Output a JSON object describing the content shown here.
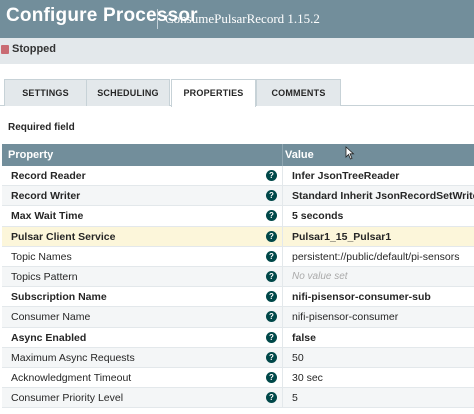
{
  "header": {
    "title": "Configure Processor",
    "subtitle": "ConsumePulsarRecord 1.15.2"
  },
  "status": {
    "text": "Stopped",
    "color": "#c96b73"
  },
  "tabs": [
    {
      "label": "SETTINGS",
      "active": false
    },
    {
      "label": "SCHEDULING",
      "active": false
    },
    {
      "label": "PROPERTIES",
      "active": true
    },
    {
      "label": "COMMENTS",
      "active": false
    }
  ],
  "required_label": "Required field",
  "table": {
    "columns": [
      "Property",
      "Value"
    ],
    "rows": [
      {
        "name": "Record Reader",
        "value": "Infer JsonTreeReader",
        "required": true,
        "highlight": false,
        "unset": false,
        "help_icon": "question-circle-icon"
      },
      {
        "name": "Record Writer",
        "value": "Standard Inherit JsonRecordSetWriter",
        "required": true,
        "highlight": false,
        "unset": false,
        "help_icon": "question-circle-icon"
      },
      {
        "name": "Max Wait Time",
        "value": "5 seconds",
        "required": true,
        "highlight": false,
        "unset": false,
        "help_icon": "question-circle-icon"
      },
      {
        "name": "Pulsar Client Service",
        "value": "Pulsar1_15_Pulsar1",
        "required": true,
        "highlight": true,
        "unset": false,
        "help_icon": "question-circle-icon"
      },
      {
        "name": "Topic Names",
        "value": "persistent://public/default/pi-sensors",
        "required": false,
        "highlight": false,
        "unset": false,
        "help_icon": "question-circle-icon"
      },
      {
        "name": "Topics Pattern",
        "value": "No value set",
        "required": false,
        "highlight": false,
        "unset": true,
        "help_icon": "question-circle-icon"
      },
      {
        "name": "Subscription Name",
        "value": "nifi-pisensor-consumer-sub",
        "required": true,
        "highlight": false,
        "unset": false,
        "help_icon": "question-circle-icon"
      },
      {
        "name": "Consumer Name",
        "value": "nifi-pisensor-consumer",
        "required": false,
        "highlight": false,
        "unset": false,
        "help_icon": "question-circle-icon"
      },
      {
        "name": "Async Enabled",
        "value": "false",
        "required": true,
        "highlight": false,
        "unset": false,
        "help_icon": "question-circle-icon"
      },
      {
        "name": "Maximum Async Requests",
        "value": "50",
        "required": false,
        "highlight": false,
        "unset": false,
        "help_icon": "question-circle-icon"
      },
      {
        "name": "Acknowledgment Timeout",
        "value": "30 sec",
        "required": false,
        "highlight": false,
        "unset": false,
        "help_icon": "question-circle-icon"
      },
      {
        "name": "Consumer Priority Level",
        "value": "5",
        "required": false,
        "highlight": false,
        "unset": false,
        "help_icon": "question-circle-icon"
      }
    ]
  },
  "colors": {
    "header_bg": "#728e9b",
    "status_bg": "#e3e8eb",
    "highlight_row": "#fcf6da",
    "help_icon": "#004849"
  }
}
